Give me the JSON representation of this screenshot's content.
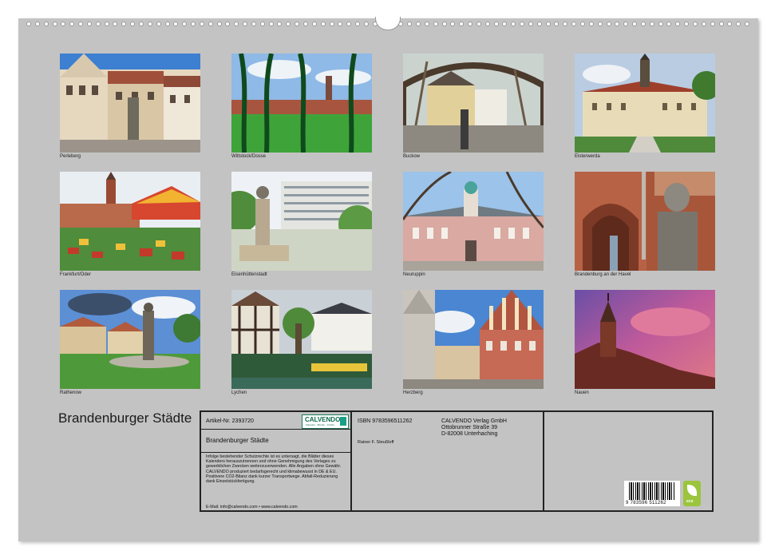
{
  "title": "Brandenburger Städte",
  "photos": [
    {
      "caption": "Perleberg"
    },
    {
      "caption": "Wittstock/Dosse"
    },
    {
      "caption": "Buckow"
    },
    {
      "caption": "Elsterwerda"
    },
    {
      "caption": "Frankfurt/Oder"
    },
    {
      "caption": "Eisenhüttenstadt"
    },
    {
      "caption": "Neuruppin"
    },
    {
      "caption": "Brandenburg an der Havel"
    },
    {
      "caption": "Rathenow"
    },
    {
      "caption": "Lychen"
    },
    {
      "caption": "Herzberg"
    },
    {
      "caption": "Nauen"
    }
  ],
  "info": {
    "article_label": "Artikel-Nr. 2393720",
    "brand_logo": "CALVENDO",
    "brand_logo_sub": "Kalender · Bücher · Puzzle",
    "product_title": "Brandenburger Städte",
    "legal_text": "Infolge bestehender Schutzrechte ist es untersagt, die Blätter dieses Kalenders herauszutrennen und ohne Genehmigung des Verlages zu gewerblichen Zwecken weiterzuverwenden. Alle Angaben ohne Gewähr. CALVENDO produziert bedarfsgerecht und klimabewusst in DE & EU. Positivere CO2-Bilanz dank kurzer Transportwege. Abfall-Reduzierung dank Einzelstückfertigung.",
    "email_line": "E-Mail: info@calvendo.com • www.calvendo.com",
    "isbn": "ISBN 9783596511262",
    "author": "Rainer F. Steußloff",
    "publisher_name": "CALVENDO Verlag GmbH",
    "publisher_street": "Ottobrunner Straße 39",
    "publisher_city": "D-82008 Unterhaching",
    "barcode_number": "9 783596 511262",
    "eco_label": "eco"
  }
}
